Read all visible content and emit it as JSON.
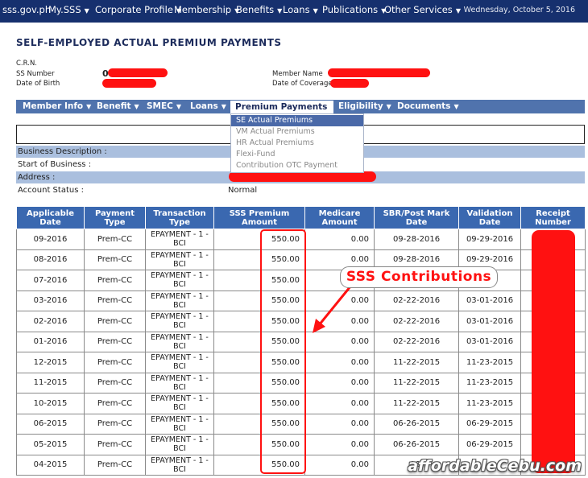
{
  "topnav": {
    "site": "sss.gov.ph",
    "items": [
      "My.SSS",
      "Corporate Profile",
      "Membership",
      "Benefits",
      "Loans",
      "Publications",
      "Other Services"
    ],
    "date": "Wednesday, October 5, 2016"
  },
  "page": {
    "title": "SELF-EMPLOYED ACTUAL PREMIUM PAYMENTS"
  },
  "member": {
    "crn_label": "C.R.N.",
    "ss_number_label": "SS Number",
    "ss_number_value": "0",
    "dob_label": "Date of Birth",
    "member_name_label": "Member Name",
    "coverage_label": "Date of Coverage"
  },
  "subnav": {
    "items": [
      "Member Info",
      "Benefit",
      "SMEC",
      "Loans"
    ],
    "active": "Premium Payments",
    "items_after": [
      "Eligibility",
      "Documents"
    ]
  },
  "dropdown": {
    "items": [
      "SE Actual Premiums",
      "VM Actual Premiums",
      "HR Actual Premiums",
      "Flexi-Fund",
      "Contribution OTC Payment"
    ],
    "selected": "SE Actual Premiums"
  },
  "business": {
    "description_label": "Business Description :",
    "start_label": "Start of Business :",
    "address_label": "Address :",
    "status_label": "Account Status :",
    "status_value": "Normal"
  },
  "table": {
    "headers": [
      "Applicable Date",
      "Payment Type",
      "Transaction Type",
      "SSS Premium Amount",
      "Medicare Amount",
      "SBR/Post Mark Date",
      "Validation Date",
      "Receipt Number"
    ],
    "rows": [
      [
        "09-2016",
        "Prem-CC",
        "EPAYMENT - 1 - BCI",
        "550.00",
        "0.00",
        "09-28-2016",
        "09-29-2016",
        ""
      ],
      [
        "08-2016",
        "Prem-CC",
        "EPAYMENT - 1 - BCI",
        "550.00",
        "0.00",
        "09-28-2016",
        "09-29-2016",
        ""
      ],
      [
        "07-2016",
        "Prem-CC",
        "EPAYMENT - 1 - BCI",
        "550.00",
        "",
        "",
        "016",
        ""
      ],
      [
        "03-2016",
        "Prem-CC",
        "EPAYMENT - 1 - BCI",
        "550.00",
        "0.00",
        "02-22-2016",
        "03-01-2016",
        ""
      ],
      [
        "02-2016",
        "Prem-CC",
        "EPAYMENT - 1 - BCI",
        "550.00",
        "0.00",
        "02-22-2016",
        "03-01-2016",
        ""
      ],
      [
        "01-2016",
        "Prem-CC",
        "EPAYMENT - 1 - BCI",
        "550.00",
        "0.00",
        "02-22-2016",
        "03-01-2016",
        ""
      ],
      [
        "12-2015",
        "Prem-CC",
        "EPAYMENT - 1 - BCI",
        "550.00",
        "0.00",
        "11-22-2015",
        "11-23-2015",
        ""
      ],
      [
        "11-2015",
        "Prem-CC",
        "EPAYMENT - 1 - BCI",
        "550.00",
        "0.00",
        "11-22-2015",
        "11-23-2015",
        ""
      ],
      [
        "10-2015",
        "Prem-CC",
        "EPAYMENT - 1 - BCI",
        "550.00",
        "0.00",
        "11-22-2015",
        "11-23-2015",
        ""
      ],
      [
        "06-2015",
        "Prem-CC",
        "EPAYMENT - 1 - BCI",
        "550.00",
        "0.00",
        "06-26-2015",
        "06-29-2015",
        ""
      ],
      [
        "05-2015",
        "Prem-CC",
        "EPAYMENT - 1 - BCI",
        "550.00",
        "0.00",
        "06-26-2015",
        "06-29-2015",
        ""
      ],
      [
        "04-2015",
        "Prem-CC",
        "EPAYMENT - 1 - BCI",
        "550.00",
        "0.00",
        "06-",
        "",
        ""
      ]
    ]
  },
  "annotation": {
    "callout": "SSS Contributions",
    "watermark": "affordableCebu.com"
  },
  "colors": {
    "topnav_bg": "#16306e",
    "subnav_bg": "#5073ad",
    "table_header_bg": "#3a68b0",
    "band_bg": "#aabfde",
    "highlight_red": "#ff1111"
  }
}
